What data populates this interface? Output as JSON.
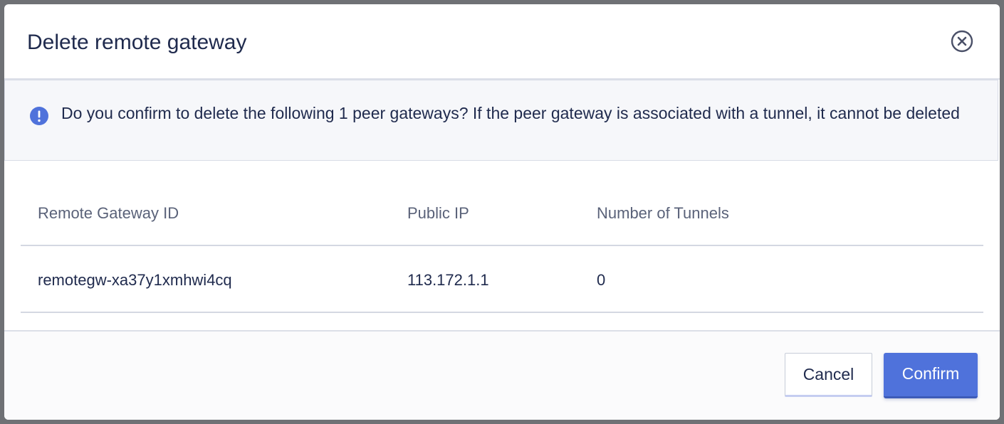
{
  "dialog": {
    "title": "Delete remote gateway",
    "close_icon": "close-circle-icon"
  },
  "alert": {
    "icon": "exclamation-circle-icon",
    "message": "Do you confirm to delete the following 1 peer gateways? If the peer gateway is associated with a tunnel, it cannot be deleted",
    "icon_color": "#4f72db"
  },
  "table": {
    "columns": [
      "Remote Gateway ID",
      "Public IP",
      "Number of Tunnels"
    ],
    "rows": [
      [
        "remotegw-xa37y1xmhwi4cq",
        "113.172.1.1",
        "0"
      ]
    ]
  },
  "footer": {
    "cancel_label": "Cancel",
    "confirm_label": "Confirm"
  },
  "colors": {
    "accent": "#4f72db",
    "text": "#1f2a4d"
  }
}
